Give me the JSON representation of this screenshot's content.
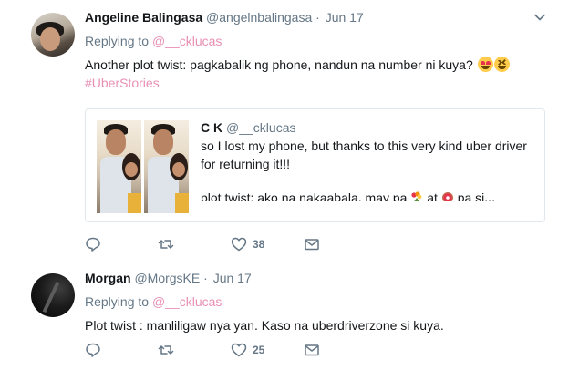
{
  "tweets": [
    {
      "name": "Angeline Balingasa",
      "handle": "@angelnbalingasa",
      "separator": "·",
      "date": "Jun 17",
      "replying_prefix": "Replying to",
      "replying_handle": "@__cklucas",
      "text": "Another plot twist: pagkabalik ng phone, nandun na number ni kuya?",
      "hashtag": "#UberStories",
      "likes": "38",
      "quote": {
        "name": "C K",
        "handle": "@__cklucas",
        "line1": "so I lost my phone, but thanks to this very kind uber driver",
        "line2": "for returning it!!!",
        "line3_a": "plot twist: ako na nakaabala, may pa",
        "line3_b": "at",
        "line3_c": "pa si..."
      }
    },
    {
      "name": "Morgan",
      "handle": "@MorgsKE",
      "separator": "·",
      "date": "Jun 17",
      "replying_prefix": "Replying to",
      "replying_handle": "@__cklucas",
      "text": "Plot twist : manliligaw nya yan. Kaso na uberdriverzone si kuya.",
      "likes": "25"
    }
  ],
  "icons": {
    "reply": "reply-icon",
    "retweet": "retweet-icon",
    "like": "heart-icon",
    "dm": "envelope-icon",
    "caret": "chevron-down-icon"
  },
  "colors": {
    "link": "#e88fb4",
    "muted": "#657786",
    "border": "#e1e8ed"
  }
}
